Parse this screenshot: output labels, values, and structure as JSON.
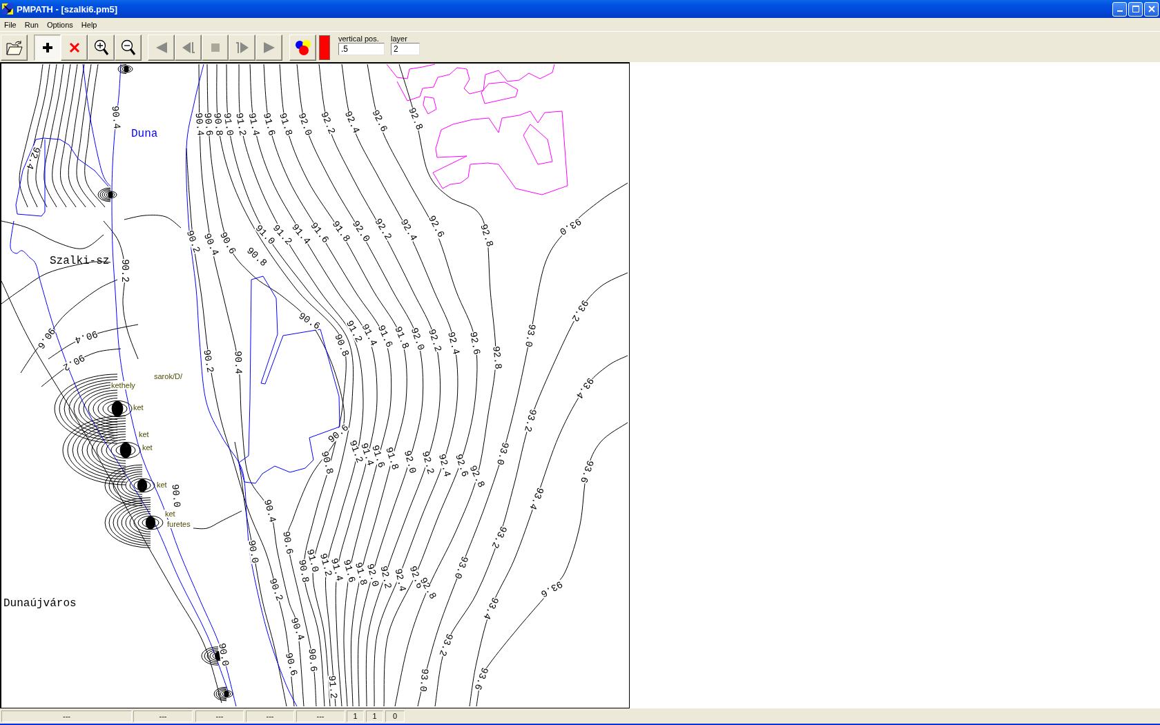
{
  "window": {
    "title": "PMPATH - [szalki6.pm5]"
  },
  "menu": [
    "File",
    "Run",
    "Options",
    "Help"
  ],
  "toolbar": {
    "buttons": [
      {
        "selected": false
      },
      {
        "selected": true
      },
      {
        "selected": false
      },
      {
        "selected": false
      },
      {
        "selected": false
      },
      {
        "selected": false
      },
      {
        "selected": false
      },
      {
        "selected": false
      },
      {
        "selected": false
      },
      {
        "selected": false
      },
      {
        "selected": false
      }
    ],
    "color": "#ff0000",
    "fields": [
      {
        "label": "vertical pos.",
        "value": ".5"
      },
      {
        "label": "layer",
        "value": "2"
      }
    ]
  },
  "map": {
    "place_labels": [
      {
        "text": "Duna",
        "color": "#0000ff"
      },
      {
        "text": "Szalki-sz",
        "color": "#000000"
      },
      {
        "text": "Dunaújváros",
        "color": "#000000"
      }
    ],
    "well_labels": [
      "kethely",
      "sarok/D/",
      "ket",
      "ket",
      "ket",
      "ket",
      "ket",
      "furetes"
    ],
    "contour_labels": [
      "90.4",
      "90.4",
      "90.6",
      "90.8",
      "91.0",
      "91.2",
      "91.4",
      "91.6",
      "91.8",
      "92.0",
      "92.2",
      "92.4",
      "92.6",
      "92.8",
      "92.4",
      "90.2",
      "90.4",
      "90.6",
      "90.8",
      "91.0",
      "91.2",
      "91.4",
      "91.6",
      "91.8",
      "92.0",
      "92.2",
      "92.4",
      "92.6",
      "92.8",
      "93.0",
      "90.2",
      "90.6",
      "90.4",
      "90.2",
      "90.2",
      "90.4",
      "90.6",
      "90.8",
      "91.2",
      "91.4",
      "91.6",
      "91.8",
      "92.0",
      "92.2",
      "92.4",
      "92.6",
      "92.8",
      "93.0",
      "93.2",
      "93.4",
      "90.0",
      "90.6",
      "90.8",
      "91.2",
      "91.4",
      "91.6",
      "91.8",
      "92.0",
      "92.2",
      "92.4",
      "92.6",
      "92.8",
      "93.0",
      "93.2",
      "93.6",
      "93.4",
      "90.4",
      "90.0",
      "90.6",
      "91.0",
      "91.2",
      "90.8",
      "91.4",
      "91.6",
      "91.8",
      "92.0",
      "92.2",
      "92.4",
      "92.6",
      "92.8",
      "93.0",
      "93.2",
      "93.6",
      "93.4",
      "90.2",
      "90.4",
      "90.0",
      "90.6",
      "90.6",
      "91.2",
      "93.2",
      "93.0",
      "93.6"
    ]
  },
  "status_bar": {
    "panels": [
      "---",
      "---",
      "---",
      "---",
      "---",
      "1",
      "1",
      "0"
    ]
  }
}
